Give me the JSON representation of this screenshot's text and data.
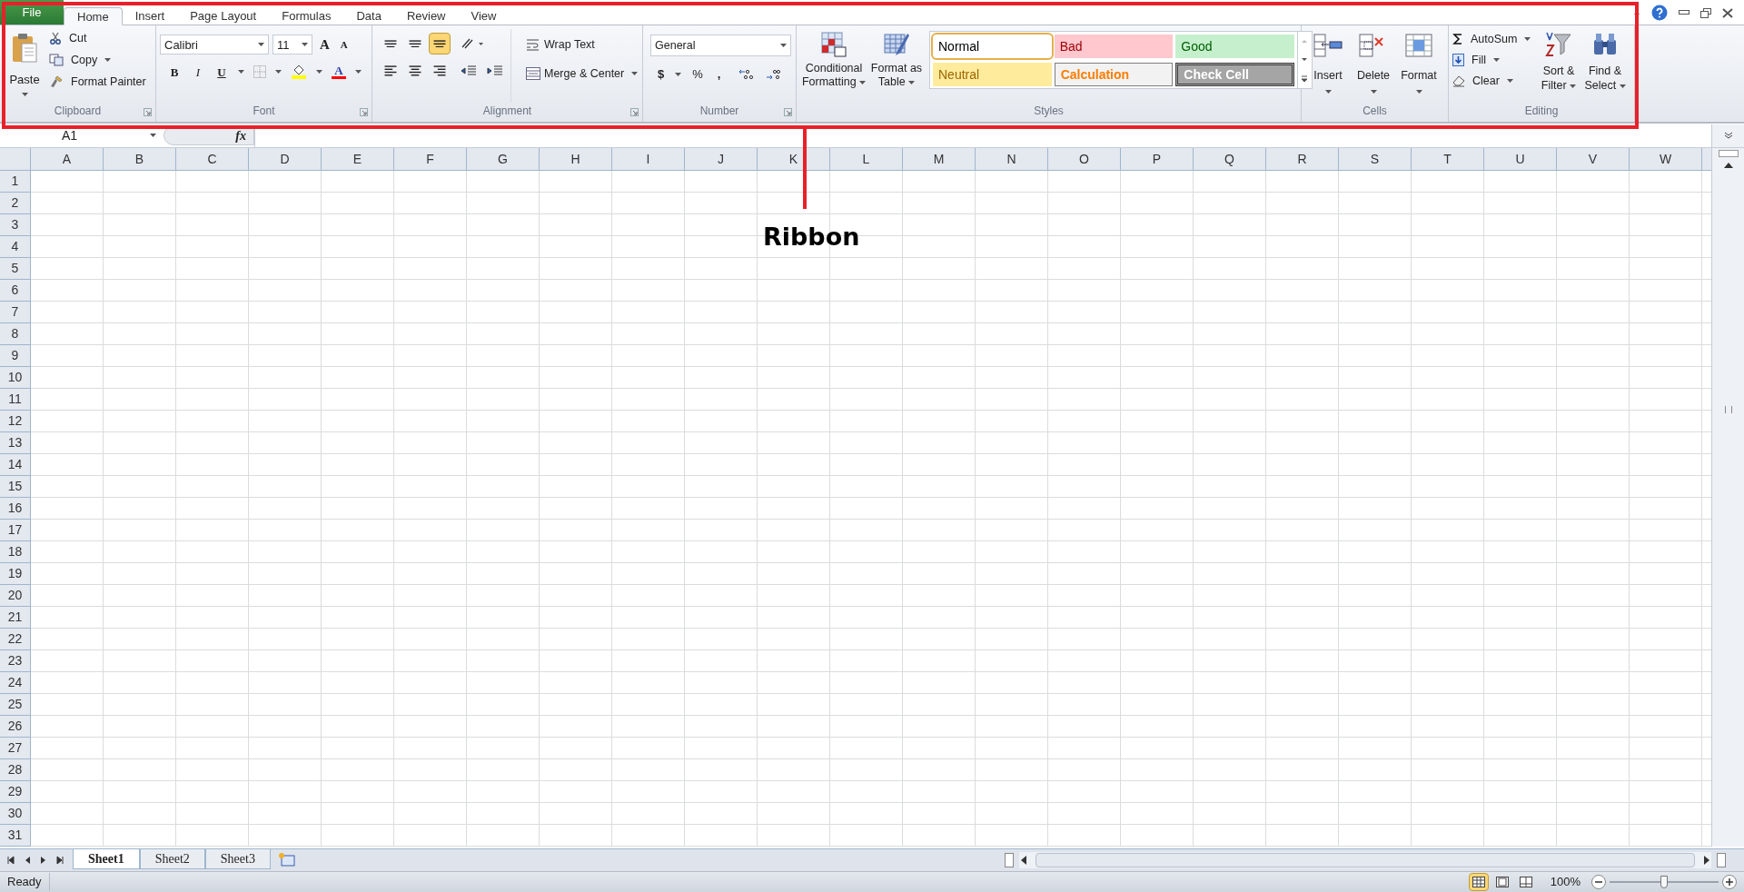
{
  "tabs": [
    {
      "label": "File",
      "kind": "file",
      "selected": false
    },
    {
      "label": "Home",
      "kind": "tab",
      "selected": true
    },
    {
      "label": "Insert",
      "kind": "tab",
      "selected": false
    },
    {
      "label": "Page Layout",
      "kind": "tab",
      "selected": false
    },
    {
      "label": "Formulas",
      "kind": "tab",
      "selected": false
    },
    {
      "label": "Data",
      "kind": "tab",
      "selected": false
    },
    {
      "label": "Review",
      "kind": "tab",
      "selected": false
    },
    {
      "label": "View",
      "kind": "tab",
      "selected": false
    }
  ],
  "clipboard": {
    "title": "Clipboard",
    "paste": "Paste",
    "cut": "Cut",
    "copy": "Copy",
    "format_painter": "Format Painter"
  },
  "font": {
    "title": "Font",
    "family": "Calibri",
    "size": "11",
    "grow": "A",
    "shrink": "A",
    "bold": "B",
    "italic": "I",
    "underline": "U",
    "font_color": "A"
  },
  "alignment": {
    "title": "Alignment",
    "wrap_text": "Wrap Text",
    "merge_center": "Merge & Center",
    "vertical": [
      {
        "selected": false
      },
      {
        "selected": false
      },
      {
        "selected": true
      }
    ],
    "horizontal": [
      {
        "selected": false
      },
      {
        "selected": false
      },
      {
        "selected": false
      }
    ]
  },
  "number": {
    "title": "Number",
    "format": "General",
    "currency": "$",
    "percent": "%",
    "comma": ","
  },
  "styles": {
    "title": "Styles",
    "conditional_formatting": "Conditional Formatting",
    "format_as_table": "Format as Table",
    "gallery": [
      {
        "label": "Normal",
        "kind": "normal",
        "selected": true
      },
      {
        "label": "Bad",
        "kind": "bad",
        "selected": false
      },
      {
        "label": "Good",
        "kind": "good",
        "selected": false
      },
      {
        "label": "Neutral",
        "kind": "neutral",
        "selected": false
      },
      {
        "label": "Calculation",
        "kind": "calculation",
        "selected": false
      },
      {
        "label": "Check Cell",
        "kind": "check",
        "selected": false
      }
    ]
  },
  "cells": {
    "title": "Cells",
    "insert": "Insert",
    "delete": "Delete",
    "format": "Format"
  },
  "editing": {
    "title": "Editing",
    "autosum": "AutoSum",
    "fill": "Fill",
    "clear": "Clear",
    "sort_filter": "Sort & Filter",
    "find_select": "Find & Select"
  },
  "formula_bar": {
    "name_box": "A1",
    "fx": "fx"
  },
  "columns": [
    "A",
    "B",
    "C",
    "D",
    "E",
    "F",
    "G",
    "H",
    "I",
    "J",
    "K",
    "L",
    "M",
    "N",
    "O",
    "P",
    "Q",
    "R",
    "S",
    "T",
    "U",
    "V",
    "W"
  ],
  "rows": [
    "1",
    "2",
    "3",
    "4",
    "5",
    "6",
    "7",
    "8",
    "9",
    "10",
    "11",
    "12",
    "13",
    "14",
    "15",
    "16",
    "17",
    "18",
    "19",
    "20",
    "21",
    "22",
    "23",
    "24",
    "25",
    "26",
    "27",
    "28",
    "29",
    "30",
    "31"
  ],
  "sheets": [
    {
      "label": "Sheet1",
      "selected": true
    },
    {
      "label": "Sheet2",
      "selected": false
    },
    {
      "label": "Sheet3",
      "selected": false
    }
  ],
  "status_bar": {
    "status": "Ready",
    "view_buttons": [
      {
        "selected": true
      },
      {
        "selected": false
      },
      {
        "selected": false
      }
    ],
    "zoom": "100%",
    "zoom_level": {
      "level": 0.5
    }
  },
  "annotation": {
    "label": "Ribbon"
  }
}
